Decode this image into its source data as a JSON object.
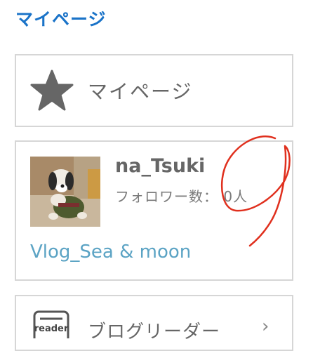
{
  "header": {
    "title": "マイページ"
  },
  "mypage_card": {
    "label": "マイページ",
    "icon": "star-icon"
  },
  "profile_card": {
    "username": "na_Tsuki",
    "followers_label": "フォロワー数：",
    "followers_count": "0人",
    "blog_name": "Vlog_Sea & moon",
    "annotation_text": "9"
  },
  "reader_card": {
    "label": "ブログリーダー",
    "icon_text": "reader",
    "chevron": "›"
  },
  "colors": {
    "accent": "#1a73c8",
    "link": "#5ba3c4",
    "text": "#666666",
    "border": "#d6d6d6",
    "annotation": "#e0301e"
  }
}
